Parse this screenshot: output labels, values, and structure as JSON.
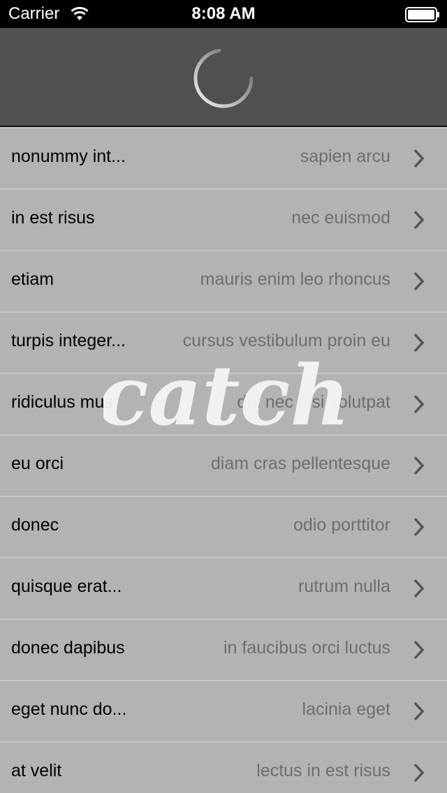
{
  "status_bar": {
    "carrier": "Carrier",
    "time": "8:08 AM"
  },
  "pull_to_refresh": {
    "state": "loading"
  },
  "list": {
    "items": [
      {
        "title": "nonummy int...",
        "detail": "sapien arcu"
      },
      {
        "title": "in est risus",
        "detail": "nec euismod"
      },
      {
        "title": "etiam",
        "detail": "mauris enim leo rhoncus"
      },
      {
        "title": "turpis integer...",
        "detail": "cursus vestibulum proin eu"
      },
      {
        "title": "ridiculus mus",
        "detail": "dui nec nisi volutpat"
      },
      {
        "title": "eu orci",
        "detail": "diam cras pellentesque"
      },
      {
        "title": "donec",
        "detail": "odio porttitor"
      },
      {
        "title": "quisque erat...",
        "detail": "rutrum nulla"
      },
      {
        "title": "donec dapibus",
        "detail": "in faucibus orci luctus"
      },
      {
        "title": "eget nunc do...",
        "detail": "lacinia eget"
      },
      {
        "title": "at velit",
        "detail": "lectus in est risus"
      }
    ]
  },
  "watermark": {
    "text": "catch"
  },
  "colors": {
    "header_bg": "#505050",
    "row_bg": "#b3b3b3",
    "title_text": "#000000",
    "detail_text": "#6e6e6e"
  }
}
